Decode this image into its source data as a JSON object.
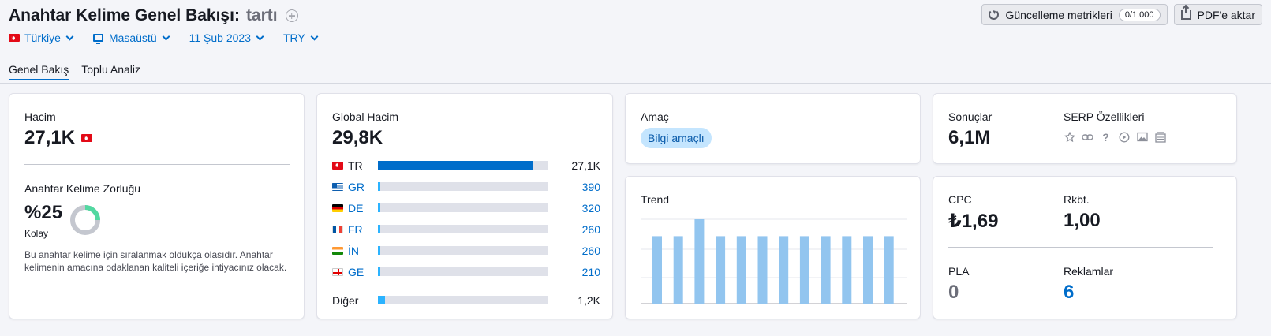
{
  "header": {
    "title": "Anahtar Kelime Genel Bakışı:",
    "keyword": "tartı",
    "filters": {
      "country": "Türkiye",
      "device": "Masaüstü",
      "date": "11 Şub 2023",
      "currency": "TRY"
    },
    "tabs": [
      {
        "label": "Genel Bakış",
        "active": true
      },
      {
        "label": "Toplu Analiz",
        "active": false
      }
    ],
    "actions": {
      "update_label": "Güncelleme metrikleri",
      "update_counter": "0/1.000",
      "export_label": "PDF'e aktar"
    }
  },
  "volume_card": {
    "label": "Hacim",
    "value": "27,1K",
    "difficulty_label": "Anahtar Kelime Zorluğu",
    "difficulty_value": "%25",
    "difficulty_level": "Kolay",
    "difficulty_percent": 25,
    "description": "Bu anahtar kelime için sıralanmak oldukça olasıdır. Anahtar kelimenin amacına odaklanan kaliteli içeriğe ihtiyacınız olacak."
  },
  "global_card": {
    "label": "Global Hacim",
    "value": "29,8K",
    "countries": [
      {
        "code": "TR",
        "flag": "tr",
        "value": "27,1K",
        "fill": 0.91,
        "link": false
      },
      {
        "code": "GR",
        "flag": "gr",
        "value": "390",
        "fill": 0.013,
        "link": true
      },
      {
        "code": "DE",
        "flag": "de",
        "value": "320",
        "fill": 0.011,
        "link": true
      },
      {
        "code": "FR",
        "flag": "fr",
        "value": "260",
        "fill": 0.009,
        "link": true
      },
      {
        "code": "İN",
        "flag": "in",
        "value": "260",
        "fill": 0.009,
        "link": true
      },
      {
        "code": "GE",
        "flag": "ge",
        "value": "210",
        "fill": 0.007,
        "link": true
      }
    ],
    "other": {
      "label": "Diğer",
      "value": "1,2K",
      "fill": 0.04
    }
  },
  "intent_card": {
    "label": "Amaç",
    "intent": "Bilgi amaçlı"
  },
  "trend_card": {
    "label": "Trend",
    "values": [
      0.8,
      0.8,
      1.0,
      0.8,
      0.8,
      0.8,
      0.8,
      0.8,
      0.8,
      0.8,
      0.8,
      0.8
    ],
    "bar_color": "#92c5ef"
  },
  "results_card": {
    "results_label": "Sonuçlar",
    "results_value": "6,1M",
    "serp_label": "SERP Özellikleri",
    "serp_icons": [
      "star-icon",
      "link-icon",
      "question-icon",
      "video-icon",
      "image-icon",
      "news-icon"
    ]
  },
  "cpc_card": {
    "cpc_label": "CPC",
    "cpc_value": "₺1,69",
    "comp_label": "Rkbt.",
    "comp_value": "1,00",
    "pla_label": "PLA",
    "pla_value": "0",
    "ads_label": "Reklamlar",
    "ads_value": "6"
  },
  "colors": {
    "accent": "#006dca",
    "donut_fill": "#53d8a1",
    "donut_track": "#c4c7cf"
  }
}
